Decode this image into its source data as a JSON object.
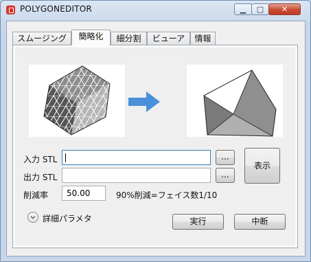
{
  "window": {
    "title": "POLYGONEDITOR",
    "min_glyph": "▁",
    "max_glyph": "□",
    "close_glyph": "✕"
  },
  "tabs": [
    {
      "label": "スムージング",
      "active": false
    },
    {
      "label": "簡略化",
      "active": true
    },
    {
      "label": "細分割",
      "active": false
    },
    {
      "label": "ビューア",
      "active": false
    },
    {
      "label": "情報",
      "active": false
    }
  ],
  "form": {
    "input_label": "入力 STL",
    "input_value": "",
    "output_label": "出力 STL",
    "output_value": "",
    "browse_label": "...",
    "ratio_label": "削減率",
    "ratio_value": "50.00",
    "ratio_hint": "90%削減=フェイス数1/10",
    "show_button": "表示"
  },
  "footer": {
    "details_label": "詳細パラメタ",
    "run_button": "実行",
    "abort_button": "中断"
  },
  "icons": {
    "app": "app-icon",
    "arrow": "arrow-right-icon",
    "details": "chevron-down-icon"
  },
  "colors": {
    "arrow": "#4a90d9",
    "close": "#c74a34"
  }
}
